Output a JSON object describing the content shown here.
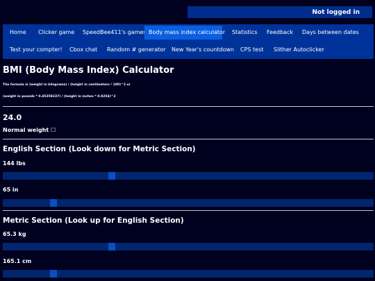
{
  "header": {
    "login_status": "Not logged in"
  },
  "nav": {
    "items": [
      {
        "label": "Home"
      },
      {
        "label": "Clicker game"
      },
      {
        "label": "SpeedBee411's games"
      },
      {
        "label": "Body mass index calculator"
      },
      {
        "label": "Statistics"
      },
      {
        "label": "Feedback"
      },
      {
        "label": "Days between dates"
      },
      {
        "label": "Test your compter!"
      },
      {
        "label": "Cbox chat"
      },
      {
        "label": "Random # generator"
      },
      {
        "label": "New Year's countdown"
      },
      {
        "label": "CPS test"
      },
      {
        "label": "Slither Autoclicker"
      }
    ],
    "active_index": 3
  },
  "main": {
    "title": "BMI (Body Mass Index) Calculator",
    "formula_line1": "The formula is (weight in kilograms) / (height in centimeters / 100)^2 or",
    "formula_line2": "(weight in pounds * 0.45359237) / (height in inches * 0.0254)^2",
    "bmi_value": "24.0",
    "bmi_status": "Normal weight ☐",
    "english": {
      "heading": "English Section (Look down for Metric Section)",
      "weight_label": "144 lbs",
      "weight_slider": 0.29,
      "height_label": "65 in",
      "height_slider": 0.13
    },
    "metric": {
      "heading": "Metric Section (Look up for English Section)",
      "weight_label": "65.3 kg",
      "weight_slider": 0.29,
      "height_label": "165.1 cm",
      "height_slider": 0.13
    }
  },
  "colors": {
    "background": "#00001f",
    "nav_background": "#00339a",
    "nav_active": "#0a5fe0",
    "slider_track": "#01266e",
    "slider_thumb": "#0a4ec4"
  }
}
